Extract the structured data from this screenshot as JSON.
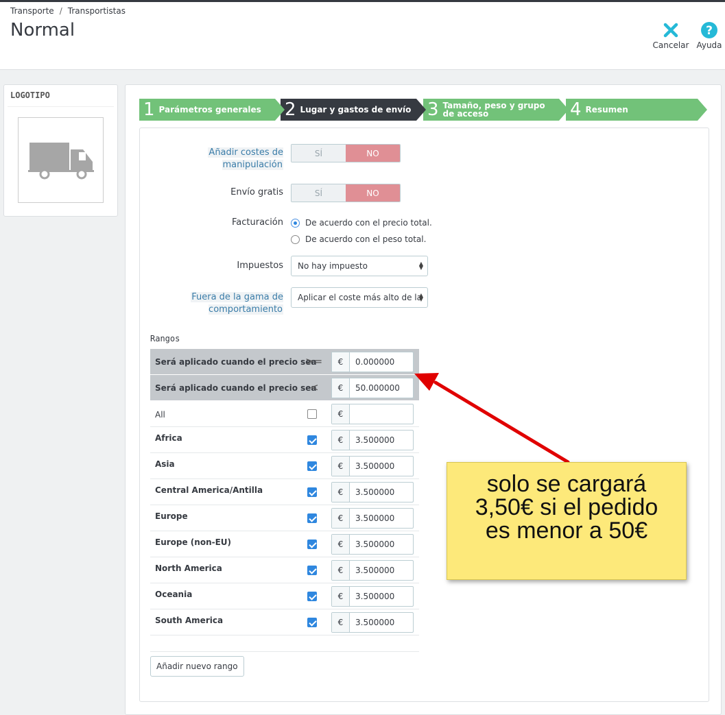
{
  "breadcrumb": {
    "parent": "Transporte",
    "current": "Transportistas"
  },
  "page_title": "Normal",
  "toolbar": {
    "cancel_label": "Cancelar",
    "help_label": "Ayuda"
  },
  "logo_panel": {
    "title": "LOGOTIPO"
  },
  "steps": [
    {
      "num": "1",
      "label": "Parámetros generales",
      "state": "done"
    },
    {
      "num": "2",
      "label": "Lugar y gastos de envío",
      "state": "active"
    },
    {
      "num": "3",
      "label": "Tamaño, peso y grupo de acceso",
      "state": "todo"
    },
    {
      "num": "4",
      "label": "Resumen",
      "state": "todo"
    }
  ],
  "form": {
    "handling": {
      "label": "Añadir costes de manipulación",
      "yes": "SÍ",
      "no": "NO",
      "selected": "NO"
    },
    "free_shipping": {
      "label": "Envío gratis",
      "yes": "SÍ",
      "no": "NO",
      "selected": "NO"
    },
    "billing": {
      "label": "Facturación",
      "options": [
        "De acuerdo con el precio total.",
        "De acuerdo con el peso total."
      ],
      "selected": 0
    },
    "tax": {
      "label": "Impuestos",
      "value": "No hay impuesto"
    },
    "out_of_range": {
      "label": "Fuera de la gama de comportamiento",
      "value": "Aplicar el coste más alto de la"
    }
  },
  "ranges": {
    "title": "Rangos",
    "currency": "€",
    "lower": {
      "label": "Será aplicado cuando el precio sea",
      "operator": ">=",
      "value": "0.000000"
    },
    "upper": {
      "label": "Será aplicado cuando el precio sea",
      "operator": "<",
      "value": "50.000000"
    },
    "all": {
      "label": "All",
      "checked": false,
      "value": ""
    },
    "zones": [
      {
        "name": "Africa",
        "checked": true,
        "value": "3.500000"
      },
      {
        "name": "Asia",
        "checked": true,
        "value": "3.500000"
      },
      {
        "name": "Central America/Antilla",
        "checked": true,
        "value": "3.500000"
      },
      {
        "name": "Europe",
        "checked": true,
        "value": "3.500000"
      },
      {
        "name": "Europe (non-EU)",
        "checked": true,
        "value": "3.500000"
      },
      {
        "name": "North America",
        "checked": true,
        "value": "3.500000"
      },
      {
        "name": "Oceania",
        "checked": true,
        "value": "3.500000"
      },
      {
        "name": "South America",
        "checked": true,
        "value": "3.500000"
      }
    ],
    "add_button": "Añadir nuevo rango"
  },
  "annotation": {
    "line1": "solo se cargará",
    "line2": "3,50€ si el pedido",
    "line3": "es menor a 50€"
  },
  "colors": {
    "accent": "#25b9d7",
    "step_done": "#72c279",
    "step_active": "#363a41",
    "switch_no": "#e08f95",
    "note": "#fde97a",
    "arrow": "#e00000"
  }
}
